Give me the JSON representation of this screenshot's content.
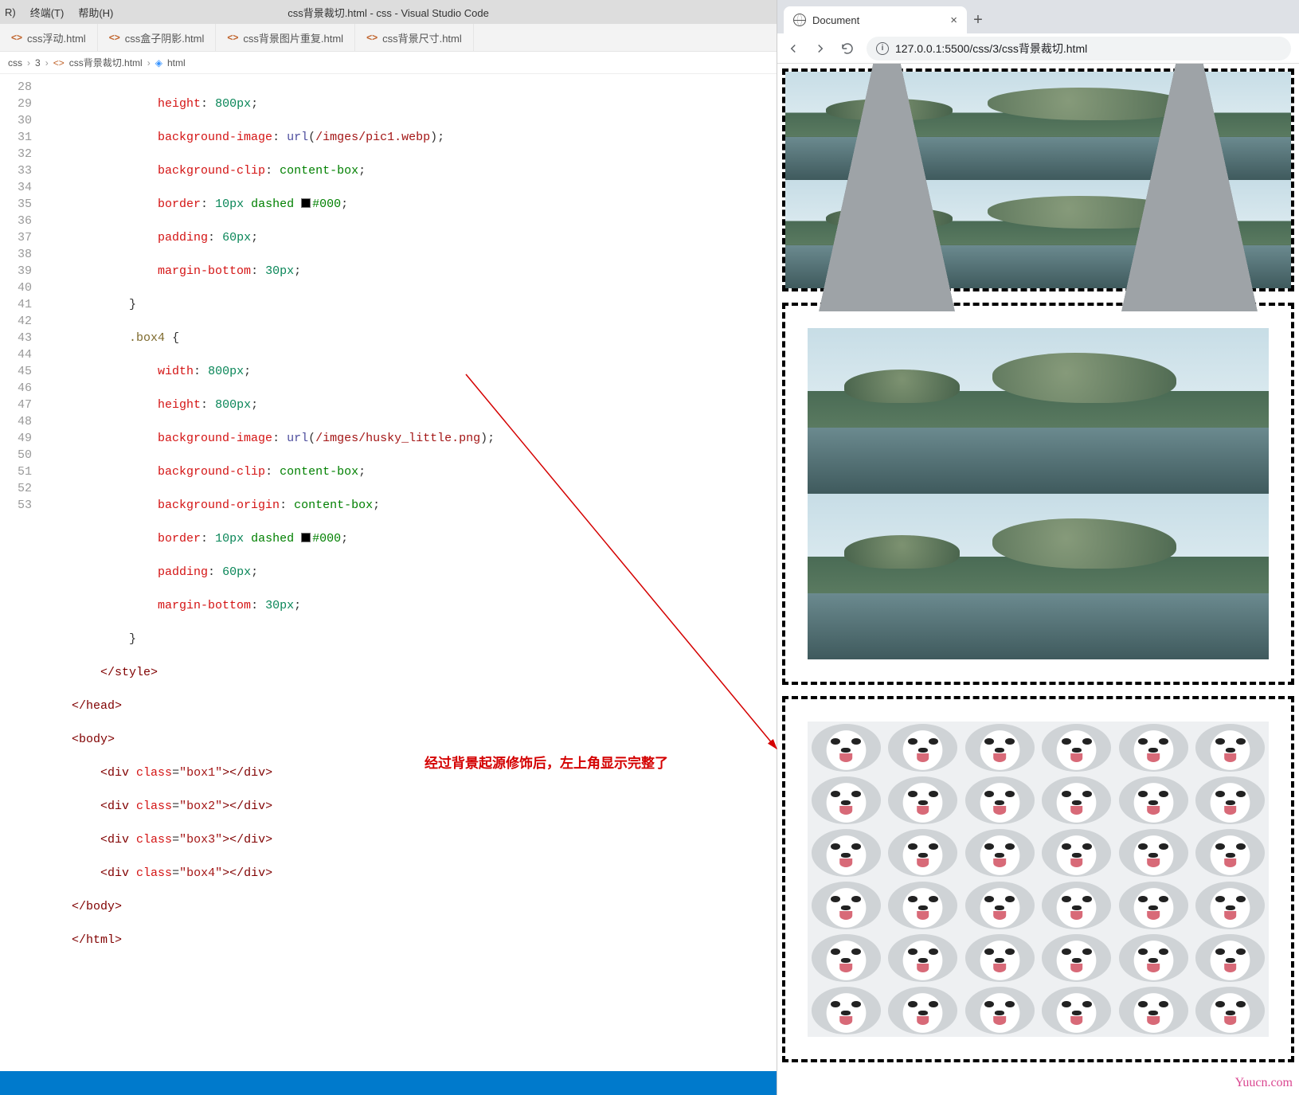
{
  "vscode": {
    "menu": {
      "run_suffix": "R)",
      "terminal": "终端(T)",
      "help": "帮助(H)"
    },
    "window_title": "css背景裁切.html - css - Visual Studio Code",
    "tabs": [
      {
        "label": "css浮动.html"
      },
      {
        "label": "css盒子阴影.html"
      },
      {
        "label": "css背景图片重复.html"
      },
      {
        "label": "css背景尺寸.html"
      }
    ],
    "breadcrumb": {
      "a": "css",
      "b": "3",
      "c": "css背景裁切.html",
      "d": "html"
    },
    "line_start": 28,
    "code": {
      "l28": "height: 800px;",
      "l29": "background-image: url(/imges/pic1.webp);",
      "l30": "background-clip: content-box;",
      "l31a": "border: ",
      "l31b": "10px",
      "l31c": " dashed ",
      "l31d": "#000",
      "l31e": ";",
      "l32": "padding: 60px;",
      "l33": "margin-bottom: 30px;",
      "l34": "}",
      "l35": ".box4 {",
      "l36": "width: 800px;",
      "l37": "height: 800px;",
      "l38": "background-image: url(/imges/husky_little.png);",
      "l39": "background-clip: content-box;",
      "l40": "background-origin: content-box;",
      "l41a": "border: ",
      "l41b": "10px",
      "l41c": " dashed ",
      "l41d": "#000",
      "l41e": ";",
      "l42": "padding: 60px;",
      "l43": "margin-bottom: 30px;",
      "l44": "}",
      "l45": "</style>",
      "l46": "</head>",
      "l47": "<body>",
      "l48": "<div class=\"box1\"></div>",
      "l49": "<div class=\"box2\"></div>",
      "l50": "<div class=\"box3\"></div>",
      "l51": "<div class=\"box4\"></div>",
      "l52": "</body>",
      "l53": "</html>"
    }
  },
  "annotation": "经过背景起源修饰后，左上角显示完整了",
  "browser": {
    "tab_title": "Document",
    "plus": "+",
    "url": "127.0.0.1:5500/css/3/css背景裁切.html"
  },
  "watermark": "Yuucn.com"
}
